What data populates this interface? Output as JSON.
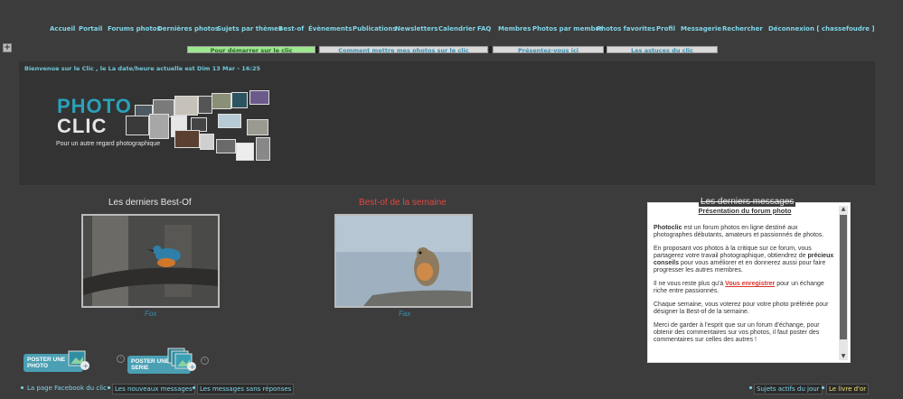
{
  "nav": {
    "items": [
      "Accueil",
      "Portail",
      "Forums photos",
      "Dernières photos",
      "Sujets par thèmes",
      "Best-of",
      "Évènements",
      "Publications",
      "Newsletters",
      "Calendrier",
      "FAQ",
      "Membres",
      "Photos par membre",
      "Photos favorites",
      "Profil",
      "Messagerie",
      "Rechercher",
      "Déconnexion [ chassefoudre ]"
    ]
  },
  "toggle_icon": "+",
  "tabs": [
    "Pour démarrer sur le clic",
    "Comment mettre mes photos sur le clic",
    "Présentez-vous ici",
    "Les astuces du clic"
  ],
  "header": {
    "welcome": "Bienvenue sur le Clic , le La date/heure actuelle est Dim 13 Mar - 16:25",
    "logo_photo": "PHOTO",
    "logo_clic": "CLIC",
    "logo_tagline": "Pour un autre regard photographique"
  },
  "bestof": {
    "title": "Les derniers Best-Of",
    "credit": "Fox"
  },
  "semaine": {
    "title": "Best-of de la semaine",
    "credit": "Fax"
  },
  "messages": {
    "title": "Les derniers messages",
    "heading": "Présentation du forum photo",
    "p1_bold": "Photoclic",
    "p1_rest": " est un forum photos en ligne destiné aux photographes débutants, amateurs et passionnés de photos.",
    "p2_a": "En proposant vos photos à la critique sur ce forum, vous partagerez votre travail photographique, obtiendrez de ",
    "p2_bold": "précieux conseils",
    "p2_b": " pour vous améliorer et en donnerez aussi pour faire progresser les autres membres.",
    "p3_a": "Il ne vous reste plus qu'à ",
    "p3_link": "Vous enregistrer",
    "p3_b": " pour un échange riche entre passionnés.",
    "p4": "Chaque semaine, vous voterez pour votre photo préférée pour désigner la Best-of de la semaine.",
    "p5": "Merci de garder à l'esprit que sur un forum d'échange, pour obtenir des commentaires sur vos photos, il faut poster des commentaires sur celles des autres !"
  },
  "buttons": {
    "post_photo": "POSTER UNE PHOTO",
    "post_serie": "POSTER UNE SERIE"
  },
  "bottom": {
    "left": [
      "La page Facebook du clic",
      "Les nouveaux messages",
      "Les messages sans réponses"
    ],
    "right": [
      "Sujets actifs du jour",
      "Le livre d'or"
    ]
  },
  "colors": {
    "accent": "#2aa1b8",
    "nav_link": "#7fd6e8",
    "active_tab": "#9de88e",
    "red_title": "#e0483e",
    "link_red": "#d9352b"
  }
}
